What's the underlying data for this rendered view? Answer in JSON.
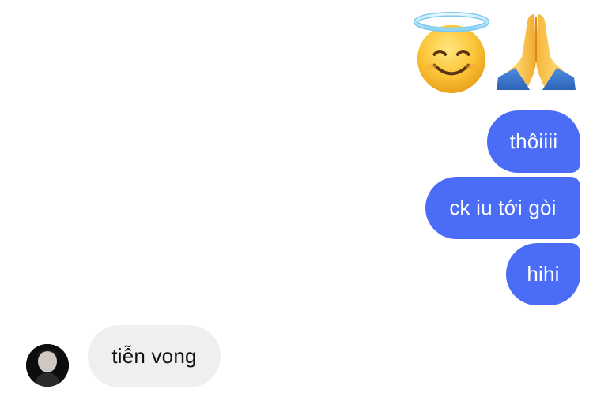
{
  "chat": {
    "reactions": [
      {
        "icon": "smiling-face-with-halo-icon"
      },
      {
        "icon": "folded-hands-icon"
      }
    ],
    "outgoing_messages": [
      {
        "text": "thôiiii"
      },
      {
        "text": "ck iu tới gòi"
      },
      {
        "text": "hihi"
      }
    ],
    "incoming_messages": [
      {
        "text": "tiễn vong",
        "avatar": "contact-avatar"
      }
    ]
  },
  "colors": {
    "outgoing_bubble": "#4a6cf7",
    "incoming_bubble": "#efefef",
    "background": "#ffffff"
  }
}
